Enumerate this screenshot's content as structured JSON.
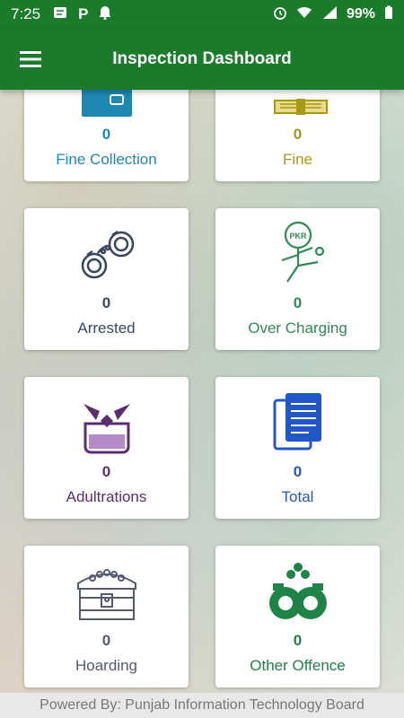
{
  "status_bar": {
    "time": "7:25",
    "battery": "99%",
    "icons": [
      "message-icon",
      "parking-icon",
      "bell-icon",
      "alarm-icon",
      "wifi-icon",
      "signal-icon",
      "battery-icon"
    ]
  },
  "app_bar": {
    "title": "Inspection Dashboard",
    "menu_icon": "hamburger-menu-icon"
  },
  "cards": [
    {
      "label": "Fine Collection",
      "count": "0",
      "icon": "wallet-icon",
      "color": "#1e88b4"
    },
    {
      "label": "Fine",
      "count": "0",
      "icon": "cash-stack-icon",
      "color": "#a79814"
    },
    {
      "label": "Arrested",
      "count": "0",
      "icon": "handcuffs-icon",
      "color": "#3a4660"
    },
    {
      "label": "Over Charging",
      "count": "0",
      "icon": "pkr-kick-icon",
      "color": "#2e8a55"
    },
    {
      "label": "Adultrations",
      "count": "0",
      "icon": "adulteration-cup-icon",
      "color": "#5a2d6e"
    },
    {
      "label": "Total",
      "count": "0",
      "icon": "documents-icon",
      "color": "#2157c6"
    },
    {
      "label": "Hoarding",
      "count": "0",
      "icon": "treasure-chest-icon",
      "color": "#545a70"
    },
    {
      "label": "Other Offence",
      "count": "0",
      "icon": "handcuffs-bold-icon",
      "color": "#1d8346"
    }
  ],
  "footer": {
    "text": "Powered By: Punjab Information Technology Board"
  }
}
